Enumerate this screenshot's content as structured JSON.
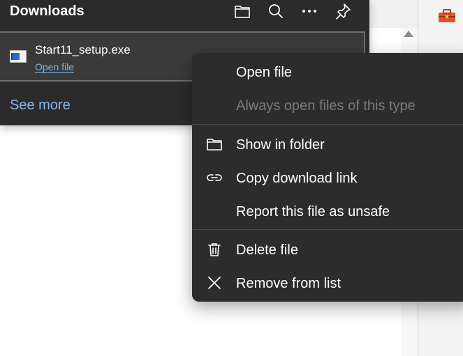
{
  "downloads": {
    "title": "Downloads",
    "header_icons": [
      "folder-icon",
      "search-icon",
      "more-icon",
      "pin-icon"
    ],
    "item": {
      "file_name": "Start11_setup.exe",
      "action_link": "Open file"
    },
    "see_more": "See more"
  },
  "context_menu": {
    "items": [
      {
        "label": "Open file",
        "icon": "",
        "enabled": true
      },
      {
        "label": "Always open files of this type",
        "icon": "",
        "enabled": false
      },
      {
        "label": "Show in folder",
        "icon": "folder-icon",
        "enabled": true
      },
      {
        "label": "Copy download link",
        "icon": "link-icon",
        "enabled": true
      },
      {
        "label": "Report this file as unsafe",
        "icon": "",
        "enabled": true
      },
      {
        "label": "Delete file",
        "icon": "trash-icon",
        "enabled": true
      },
      {
        "label": "Remove from list",
        "icon": "close-icon",
        "enabled": true
      }
    ]
  },
  "colors": {
    "panel_bg": "#2b2b2b",
    "menu_bg": "#2c2c2c",
    "link": "#7ab6ea",
    "text": "#ffffff",
    "disabled_text": "#7a7a7a"
  }
}
